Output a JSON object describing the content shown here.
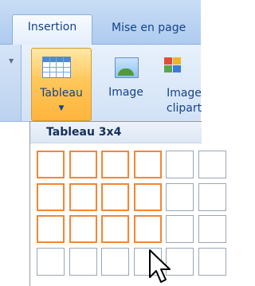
{
  "tabs": {
    "insertion": "Insertion",
    "mise_en_page": "Mise en page"
  },
  "ribbon": {
    "tableau_label": "Tableau",
    "image_label": "Image",
    "clipart_line1": "Image",
    "clipart_line2": "clipart"
  },
  "dropdown": {
    "title": "Tableau 3x4",
    "selected_columns": 4,
    "selected_rows": 3
  },
  "colors": {
    "accent_orange": "#f48634",
    "ribbon_blue": "#15428b"
  }
}
